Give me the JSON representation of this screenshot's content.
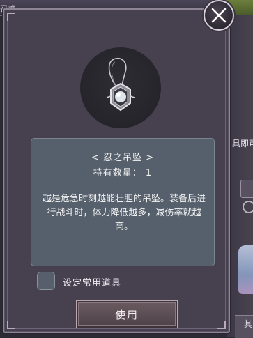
{
  "background": {
    "top_title": "召唤",
    "right_text": "具即可",
    "right_bottom_text": "其"
  },
  "modal": {
    "item": {
      "name": "< 忍之吊坠 >",
      "quantity": "持有数量： 1",
      "description": "越是危急时刻越能壮胆的吊坠。装备后进行战斗时，体力降低越多，减伤率就越高。"
    },
    "favorite_label": "设定常用道具",
    "use_button": "使用"
  },
  "icons": {
    "close": "close-icon",
    "item": "pendant-icon"
  },
  "colors": {
    "panel": "#46404f",
    "desc_box": "#56606c",
    "button": "#5c4e55"
  }
}
